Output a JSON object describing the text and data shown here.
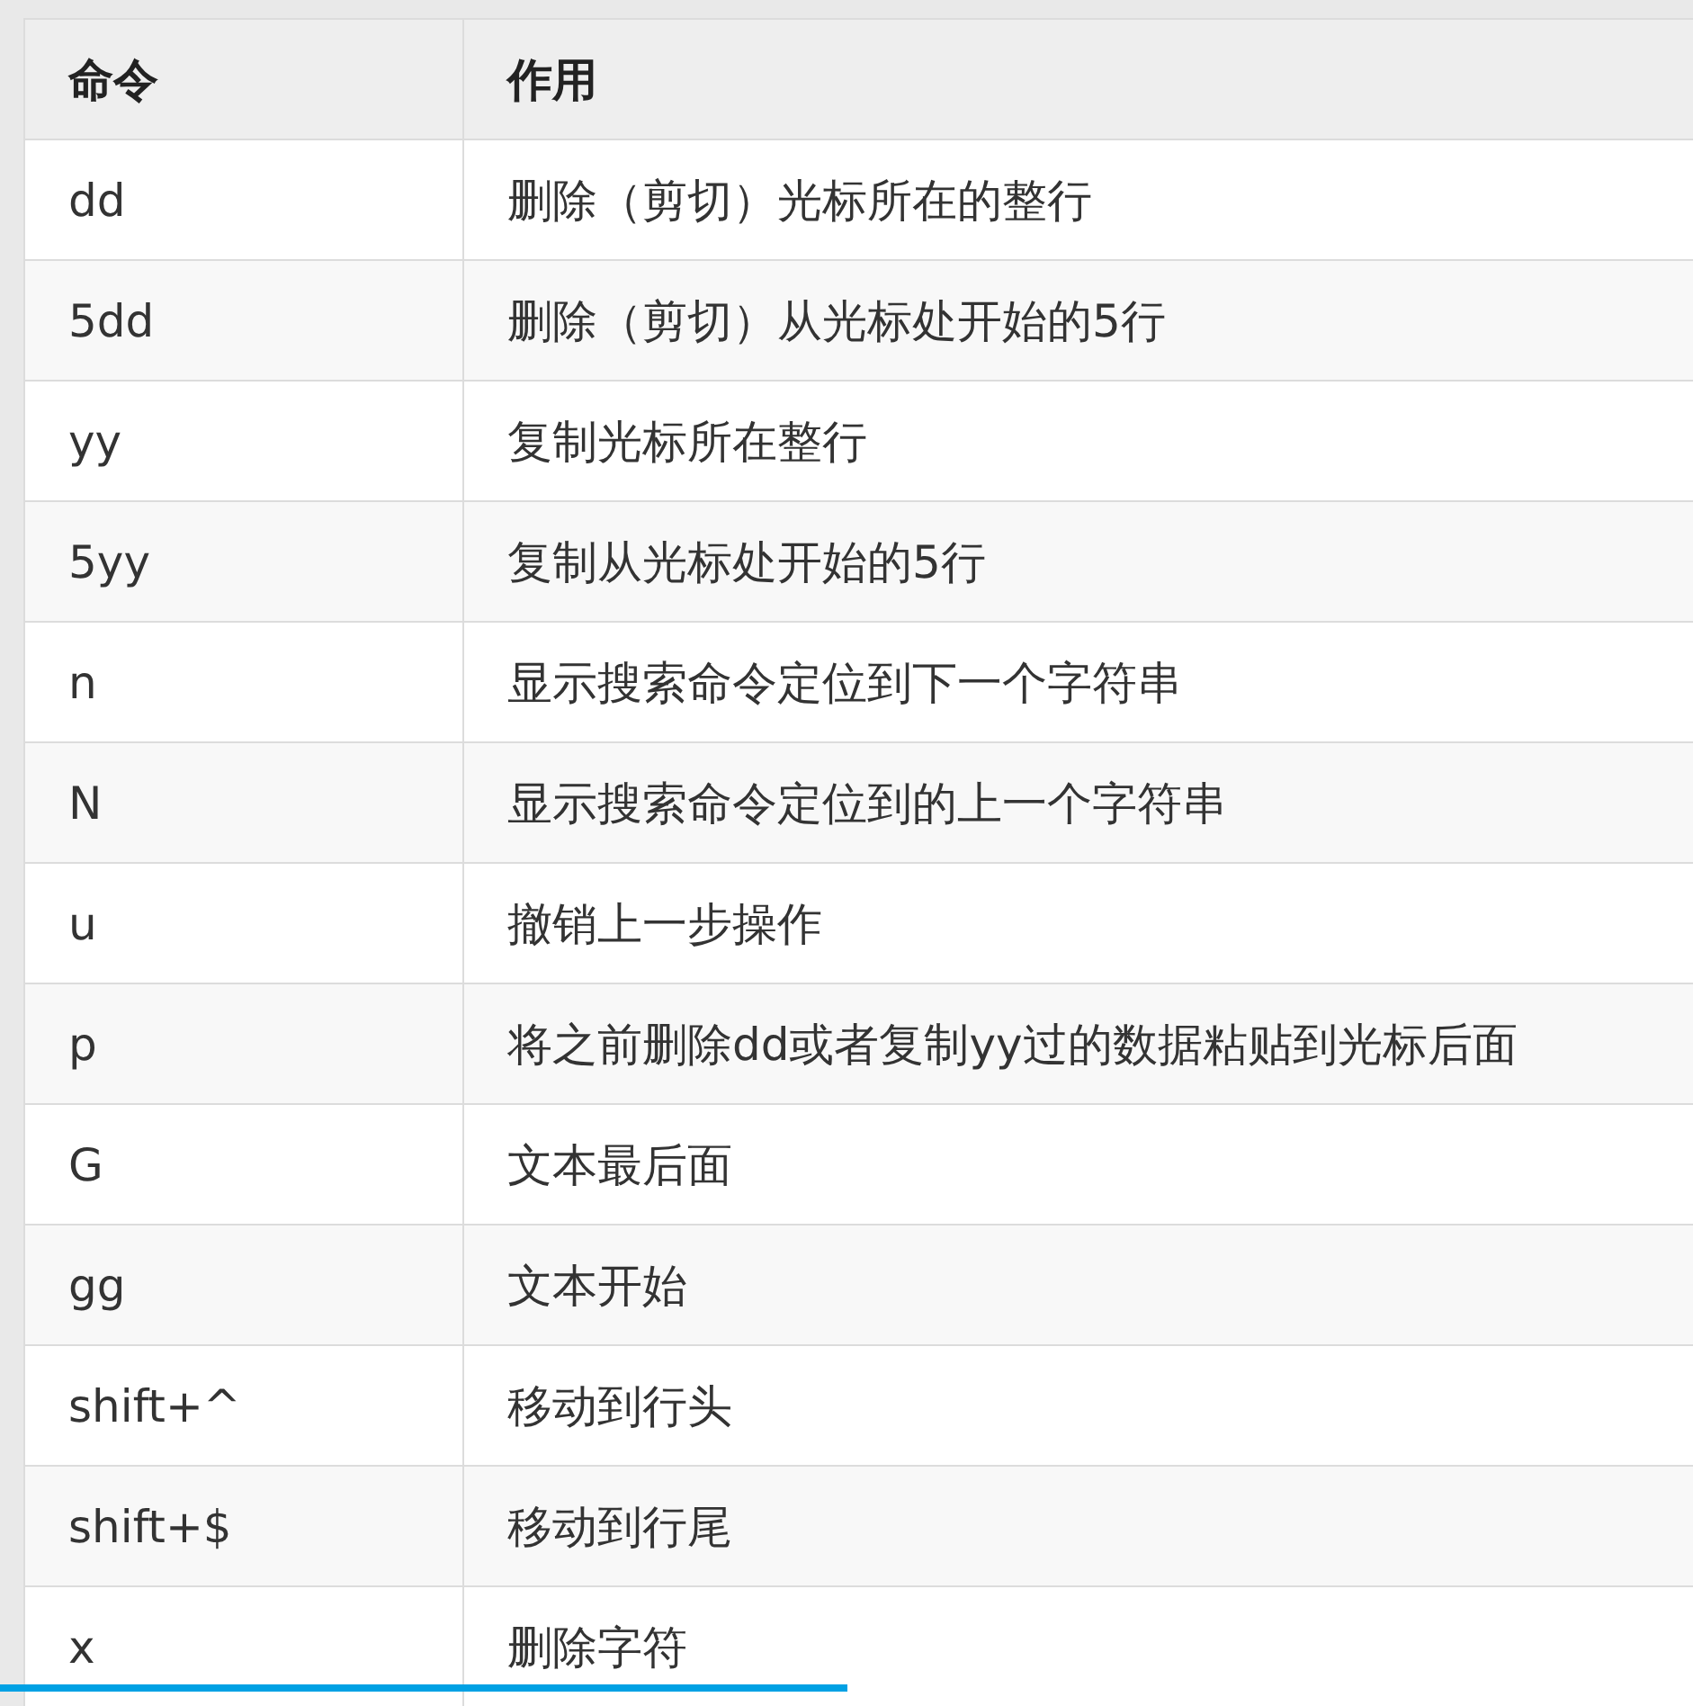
{
  "table": {
    "columns": [
      "命令",
      "作用"
    ],
    "rows": [
      [
        "dd",
        "删除（剪切）光标所在的整行"
      ],
      [
        "5dd",
        "删除（剪切）从光标处开始的5行"
      ],
      [
        "yy",
        "复制光标所在整行"
      ],
      [
        "5yy",
        "复制从光标处开始的5行"
      ],
      [
        "n",
        "显示搜索命令定位到下一个字符串"
      ],
      [
        "N",
        "显示搜索命令定位到的上一个字符串"
      ],
      [
        "u",
        "撤销上一步操作"
      ],
      [
        "p",
        "将之前删除dd或者复制yy过的数据粘贴到光标后面"
      ],
      [
        "G",
        "文本最后面"
      ],
      [
        "gg",
        "文本开始"
      ],
      [
        "shift+^",
        "移动到行头"
      ],
      [
        "shift+$",
        "移动到行尾"
      ],
      [
        "x",
        "删除字符"
      ]
    ]
  },
  "progress_bar": {
    "level": 0.5
  }
}
